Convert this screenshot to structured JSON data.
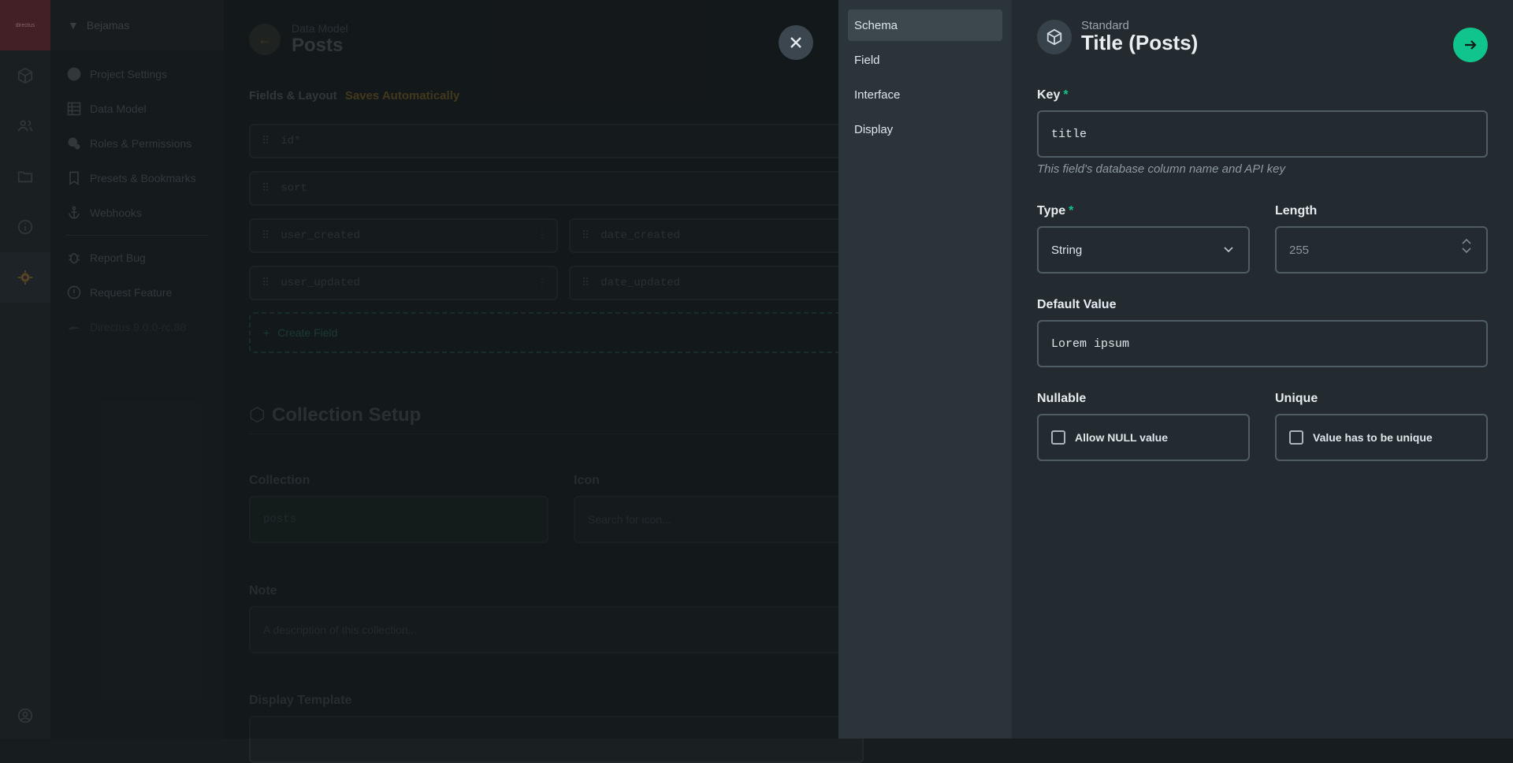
{
  "module_bar": {
    "logo_text": "directus",
    "items": [
      "cube-icon",
      "users-icon",
      "folder-icon",
      "info-icon",
      "settings-icon"
    ],
    "bottom_icon": "account-icon"
  },
  "nav": {
    "project": "Bejamas",
    "items": [
      {
        "label": "Project Settings",
        "icon": "globe-icon"
      },
      {
        "label": "Data Model",
        "icon": "list-icon"
      },
      {
        "label": "Roles & Permissions",
        "icon": "roles-icon"
      },
      {
        "label": "Presets & Bookmarks",
        "icon": "bookmark-icon"
      },
      {
        "label": "Webhooks",
        "icon": "anchor-icon"
      }
    ],
    "secondary": [
      {
        "label": "Report Bug",
        "icon": "bug-icon"
      },
      {
        "label": "Request Feature",
        "icon": "feature-icon"
      }
    ],
    "version": "Directus 9.0.0-rc.88"
  },
  "content": {
    "breadcrumb": "Data Model",
    "title": "Posts",
    "section_label": "Fields & Layout",
    "saves_label": "Saves Automatically",
    "fields": {
      "id": "id*",
      "sort": "sort",
      "user_created": "user_created",
      "date_created": "date_created",
      "user_updated": "user_updated",
      "date_updated": "date_updated"
    },
    "create_field": "Create Field",
    "collection_setup": "Collection Setup",
    "collection_label": "Collection",
    "collection_value": "posts",
    "icon_label": "Icon",
    "icon_placeholder": "Search for icon...",
    "note_label": "Note",
    "note_placeholder": "A description of this collection...",
    "display_template_label": "Display Template"
  },
  "drawer": {
    "tabs": [
      "Schema",
      "Field",
      "Interface",
      "Display"
    ],
    "active_tab": "Schema",
    "subtitle": "Standard",
    "title": "Title (Posts)",
    "key_label": "Key",
    "key_value": "title",
    "key_hint": "This field's database column name and API key",
    "type_label": "Type",
    "type_value": "String",
    "length_label": "Length",
    "length_value": "255",
    "default_label": "Default Value",
    "default_value": "Lorem ipsum",
    "nullable_label": "Nullable",
    "nullable_option": "Allow NULL value",
    "unique_label": "Unique",
    "unique_option": "Value has to be unique",
    "accent_color": "#10c48d"
  }
}
